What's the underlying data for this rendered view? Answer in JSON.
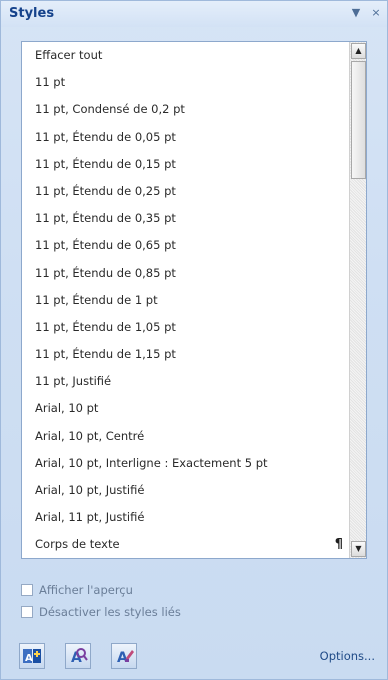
{
  "header": {
    "title": "Styles",
    "dropdown_glyph": "▼",
    "close_glyph": "×"
  },
  "list": {
    "items": [
      "Effacer tout",
      "11 pt",
      "11 pt, Condensé de 0,2 pt",
      "11 pt, Étendu de 0,05 pt",
      "11 pt, Étendu de 0,15 pt",
      "11 pt, Étendu de 0,25 pt",
      "11 pt, Étendu de 0,35 pt",
      "11 pt, Étendu de 0,65 pt",
      "11 pt, Étendu de 0,85 pt",
      "11 pt, Étendu de 1 pt",
      "11 pt, Étendu de 1,05 pt",
      "11 pt, Étendu de 1,15 pt",
      "11 pt, Justifié",
      "Arial, 10 pt",
      "Arial, 10 pt, Centré",
      "Arial, 10 pt, Interligne : Exactement 5 pt",
      "Arial, 10 pt, Justifié",
      "Arial, 11 pt, Justifié",
      "Corps de texte"
    ],
    "pilcrow": "¶",
    "scroll_up_glyph": "▲",
    "scroll_down_glyph": "▼"
  },
  "options": {
    "show_preview_label": "Afficher l'aperçu",
    "disable_linked_label": "Désactiver les styles liés"
  },
  "footer": {
    "options_label": "Options..."
  },
  "icons": {
    "new_style": "new-style-icon",
    "style_inspector": "style-inspector-icon",
    "manage_styles": "manage-styles-icon"
  },
  "colors": {
    "accent": "#15428b",
    "pane_bg": "#cfdff3"
  }
}
